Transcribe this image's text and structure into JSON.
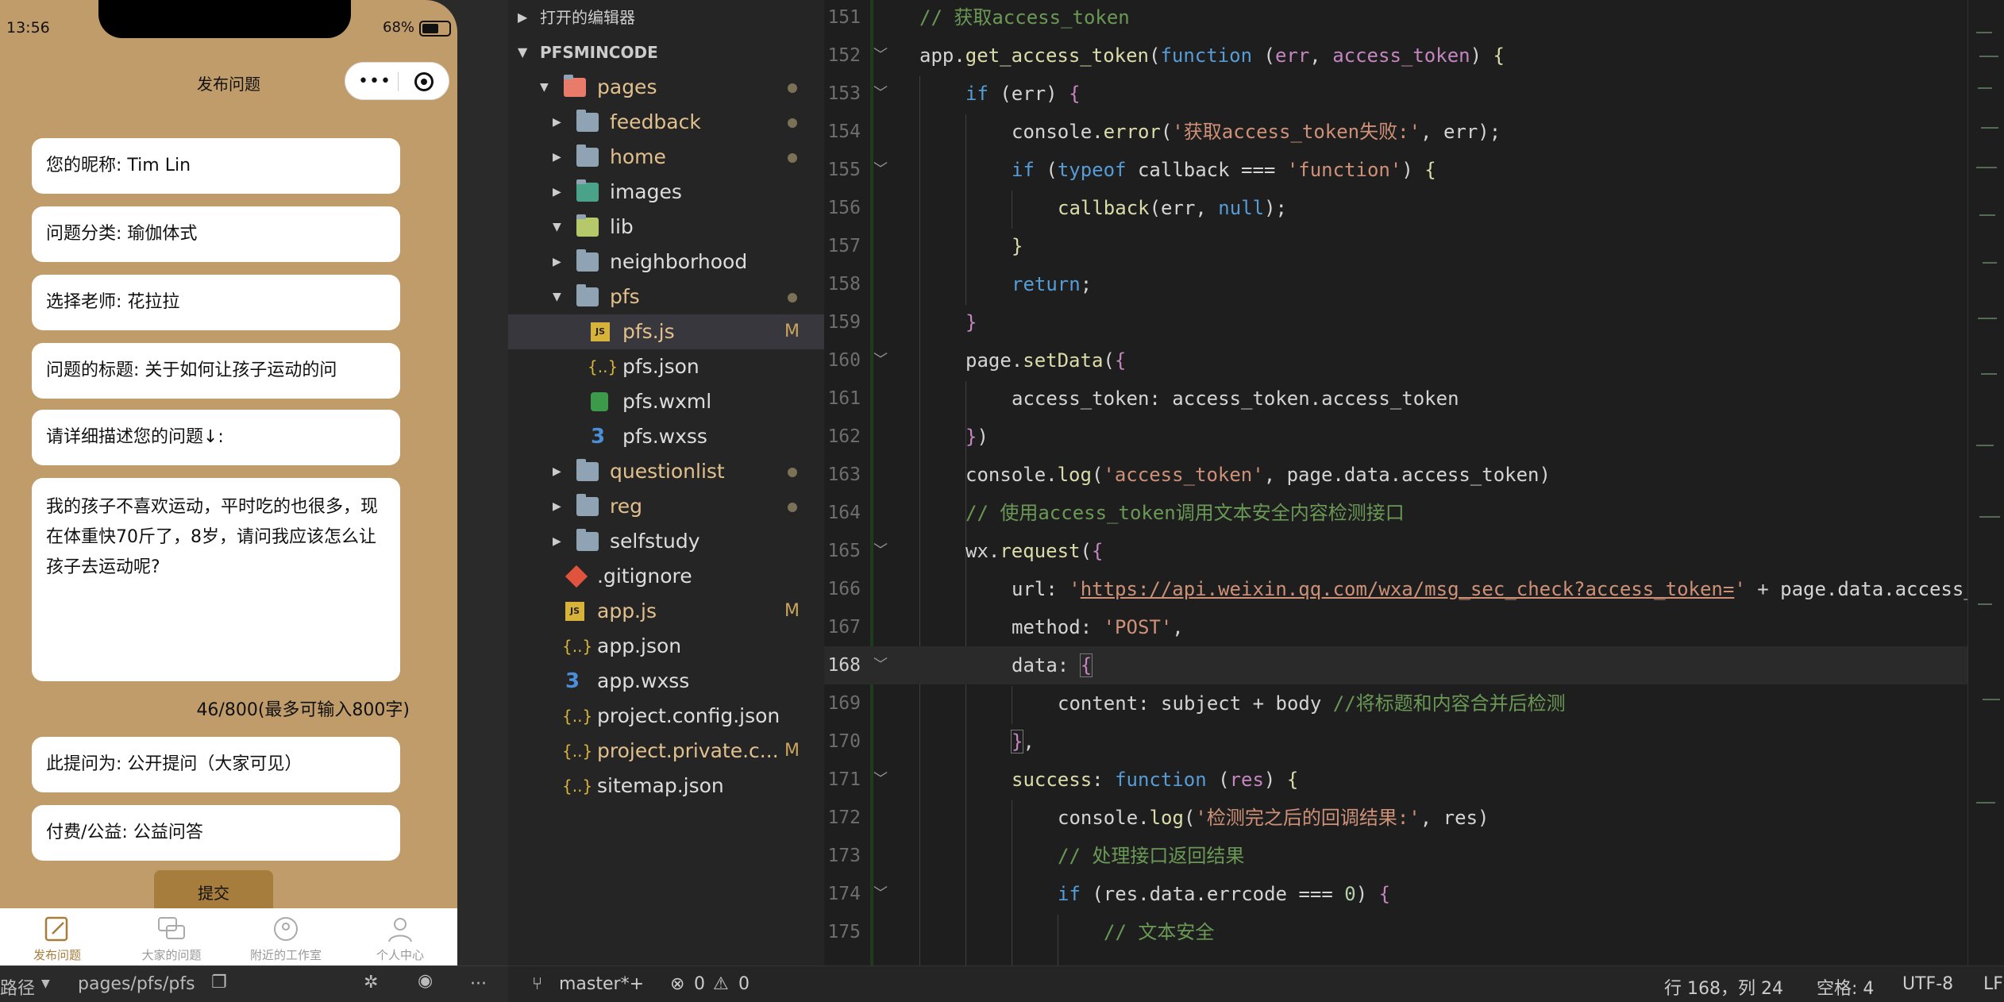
{
  "simulator": {
    "status_time": "13:56",
    "battery": "68%",
    "nav_title": "发布问题",
    "capsule_more": "•••",
    "form": {
      "nickname": "您的昵称:  Tim Lin",
      "category": "问题分类:  瑜伽体式",
      "teacher": "选择老师:  花拉拉",
      "title": "问题的标题:  关于如何让孩子运动的问",
      "describe_label": "请详细描述您的问题↓:",
      "description": "我的孩子不喜欢运动，平时吃的也很多，现在体重快70斤了，8岁，请问我应该怎么让孩子去运动呢?",
      "counter": "46/800(最多可输入800字)",
      "visibility": "此提问为:  公开提问（大家可见）",
      "payment": "付费/公益:  公益问答",
      "submit": "提交"
    },
    "tabs": [
      {
        "label": "发布问题",
        "icon": "edit-icon"
      },
      {
        "label": "大家的问题",
        "icon": "chat-icon"
      },
      {
        "label": "附近的工作室",
        "icon": "location-icon"
      },
      {
        "label": "个人中心",
        "icon": "user-icon"
      }
    ],
    "bottom": {
      "path_label": "路径",
      "path": "pages/pfs/pfs"
    }
  },
  "explorer": {
    "open_editors": "打开的编辑器",
    "project": "PFSMINCODE",
    "items": [
      {
        "name": "pages",
        "type": "folder-open",
        "color": "#e97b6a"
      },
      {
        "name": "feedback",
        "type": "folder"
      },
      {
        "name": "home",
        "type": "folder"
      },
      {
        "name": "images",
        "type": "folder"
      },
      {
        "name": "lib",
        "type": "folder-open"
      },
      {
        "name": "neighborhood",
        "type": "folder"
      },
      {
        "name": "pfs",
        "type": "folder-open"
      },
      {
        "name": "pfs.js",
        "type": "js",
        "badge": "M"
      },
      {
        "name": "pfs.json",
        "type": "json"
      },
      {
        "name": "pfs.wxml",
        "type": "wxml"
      },
      {
        "name": "pfs.wxss",
        "type": "wxss"
      },
      {
        "name": "questionlist",
        "type": "folder"
      },
      {
        "name": "reg",
        "type": "folder"
      },
      {
        "name": "selfstudy",
        "type": "folder"
      },
      {
        "name": ".gitignore",
        "type": "git"
      },
      {
        "name": "app.js",
        "type": "js",
        "badge": "M"
      },
      {
        "name": "app.json",
        "type": "json"
      },
      {
        "name": "app.wxss",
        "type": "wxss"
      },
      {
        "name": "project.config.json",
        "type": "json"
      },
      {
        "name": "project.private.c...",
        "type": "json",
        "badge": "M"
      },
      {
        "name": "sitemap.json",
        "type": "json"
      }
    ]
  },
  "editor": {
    "line_numbers": [
      "151",
      "152",
      "153",
      "154",
      "155",
      "156",
      "157",
      "158",
      "159",
      "160",
      "161",
      "162",
      "163",
      "164",
      "165",
      "166",
      "167",
      "168",
      "169",
      "170",
      "171",
      "172",
      "173",
      "174",
      "175"
    ],
    "current_line": "168",
    "url": "https://api.weixin.qq.com/wxa/msg_sec_check?access_token="
  },
  "statusbar": {
    "branch": "master*+",
    "errors": "0",
    "warnings": "0",
    "position": "行 168，列 24",
    "spaces": "空格: 4",
    "encoding": "UTF-8",
    "eol": "LF"
  }
}
